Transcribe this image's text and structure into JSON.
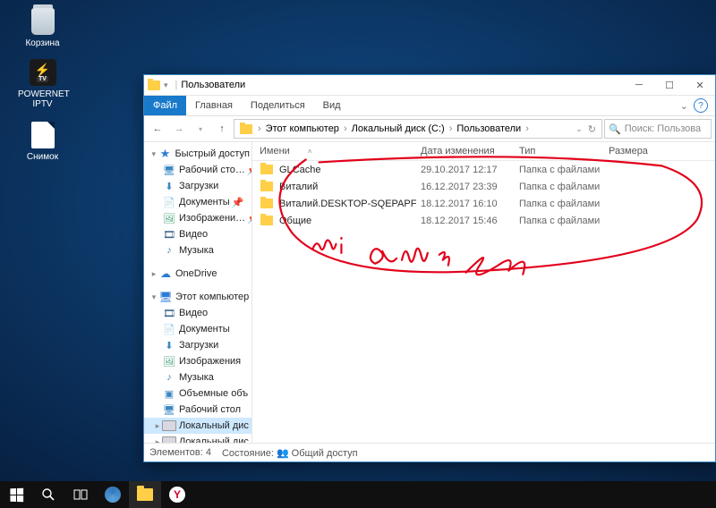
{
  "desktop": {
    "icons": [
      {
        "label": "Корзина"
      },
      {
        "label": "POWERNET IPTV"
      },
      {
        "label": "Снимок"
      }
    ]
  },
  "window": {
    "title": "Пользователи",
    "tabs": {
      "file": "Файл",
      "home": "Главная",
      "share": "Поделиться",
      "view": "Вид"
    },
    "breadcrumb": [
      "Этот компьютер",
      "Локальный диск (C:)",
      "Пользователи"
    ],
    "search_placeholder": "Поиск: Пользова",
    "columns": {
      "name": "Имени",
      "date": "Дата изменения",
      "type": "Тип",
      "size": "Размера"
    },
    "nav": {
      "quick": "Быстрый доступ",
      "quick_items": [
        "Рабочий сто…",
        "Загрузки",
        "Документы",
        "Изображени…",
        "Видео",
        "Музыка"
      ],
      "onedrive": "OneDrive",
      "thispc": "Этот компьютер",
      "pc_items": [
        "Видео",
        "Документы",
        "Загрузки",
        "Изображения",
        "Музыка",
        "Объемные объ",
        "Рабочий стол"
      ],
      "local_disk": "Локальный дис",
      "local_disk2": "Локальный дис"
    },
    "files": [
      {
        "name": "GLCache",
        "date": "29.10.2017 12:17",
        "type": "Папка с файлами"
      },
      {
        "name": "Виталий",
        "date": "16.12.2017 23:39",
        "type": "Папка с файлами"
      },
      {
        "name": "Виталий.DESKTOP-SQEPAPF",
        "date": "18.12.2017 16:10",
        "type": "Папка с файлами"
      },
      {
        "name": "Общие",
        "date": "18.12.2017 15:46",
        "type": "Папка с файлами"
      }
    ],
    "status": {
      "count_label": "Элементов: 4",
      "state_label": "Состояние:",
      "state_value": "Общий доступ"
    }
  }
}
